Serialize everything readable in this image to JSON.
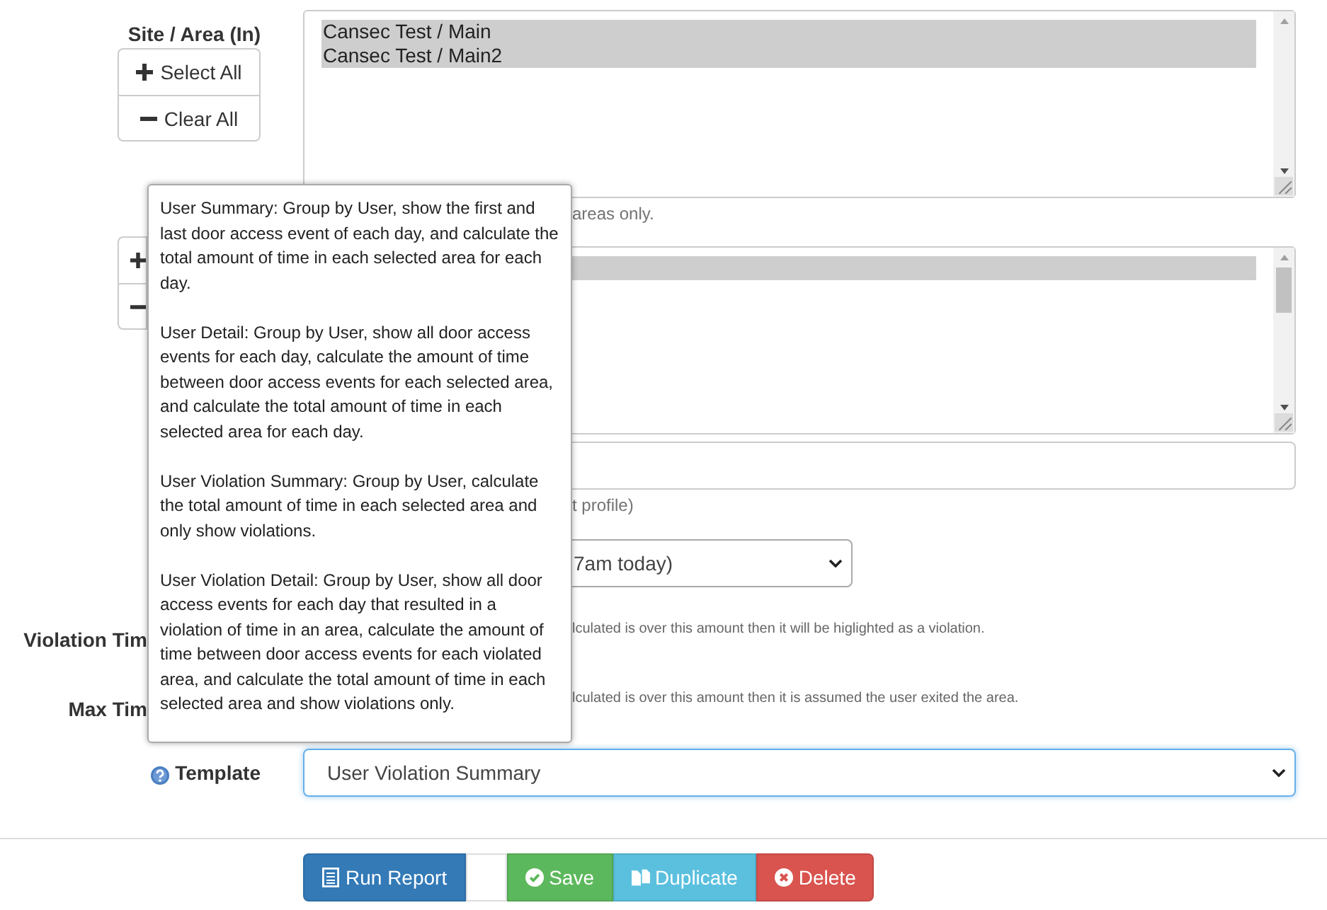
{
  "site_area": {
    "label": "Site / Area (In)",
    "buttons": [
      "Select All",
      "Clear All"
    ],
    "options": [
      {
        "text": "Cansec Test / Main",
        "selected": true
      },
      {
        "text": "Cansec Test / Main2",
        "selected": true
      }
    ],
    "hint": "areas only."
  },
  "second_list": {
    "options": [
      {
        "selected": true
      }
    ]
  },
  "profile_hint": "t profile)",
  "period_select": {
    "value": "7am today)"
  },
  "violation_time": {
    "label": "Violation Tim",
    "hint": "lculated is over this amount then it will be higlighted as a violation."
  },
  "max_time": {
    "label": "Max Tim",
    "hint": "lculated is over this amount then it is assumed the user exited the area."
  },
  "template": {
    "label": "Template",
    "value": "User Violation Summary"
  },
  "tooltip": {
    "paragraphs": [
      "User Summary: Group by User, show the first and last door access event of each day, and calculate the total amount of time in each selected area for each day.",
      "User Detail: Group by User, show all door access events for each day, calculate the amount of time between door access events for each selected area, and calculate the total amount of time in each selected area for each day.",
      "User Violation Summary: Group by User, calculate the total amount of time in each selected area and only show violations.",
      "User Violation Detail: Group by User, show all door access events for each day that resulted in a violation of time in an area, calculate the amount of time between door access events for each violated area, and calculate the total amount of time in each selected area and show violations only."
    ]
  },
  "actions": [
    {
      "kind": "run",
      "label": "Run Report"
    },
    {
      "kind": "blank"
    },
    {
      "kind": "save",
      "label": "Save"
    },
    {
      "kind": "duplicate",
      "label": "Duplicate"
    },
    {
      "kind": "delete",
      "label": "Delete"
    }
  ]
}
